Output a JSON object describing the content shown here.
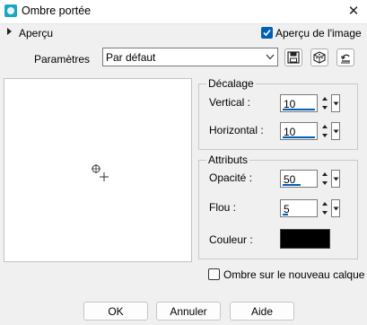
{
  "window": {
    "title": "Ombre portée",
    "icon": "shadow-app-icon",
    "close_icon": "close-icon"
  },
  "preview": {
    "label": "Aperçu",
    "image_preview_label": "Aperçu de l'image",
    "image_preview_checked": true
  },
  "parameters": {
    "label": "Paramètres",
    "preset_value": "Par défaut",
    "tools": [
      "save-preset-icon",
      "randomize-icon",
      "reset-icon"
    ]
  },
  "offset": {
    "legend": "Décalage",
    "vertical_label": "Vertical :",
    "vertical_value": "10",
    "horizontal_label": "Horizontal :",
    "horizontal_value": "10"
  },
  "attributes": {
    "legend": "Attributs",
    "opacity_label": "Opacité :",
    "opacity_value": "50",
    "blur_label": "Flou :",
    "blur_value": "5",
    "color_label": "Couleur :",
    "color_value": "#000000"
  },
  "new_layer": {
    "label": "Ombre sur le nouveau calque",
    "checked": false
  },
  "buttons": {
    "ok": "OK",
    "cancel": "Annuler",
    "help": "Aide"
  }
}
